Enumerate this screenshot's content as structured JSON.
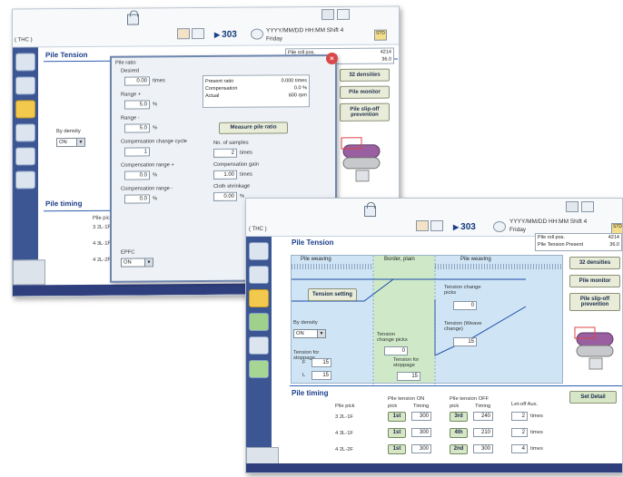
{
  "back": {
    "mode_label": "THC",
    "speed": "303",
    "date_line1": "YYYY/MM/DD HH:MM Shift 4",
    "date_line2": "Friday",
    "std_label": "STD",
    "panel_title": "Pile Tension",
    "info": [
      {
        "label": "Pile roll pos.",
        "value": "4214"
      },
      {
        "label": "",
        "value": "36.0"
      }
    ],
    "buttons": {
      "densities": "32 densities",
      "monitor": "Pile monitor",
      "slipoff": "Pile slip-off prevention"
    },
    "by_density_label": "By density",
    "by_density_value": "ON",
    "pile_timing_title": "Pile timing",
    "timing_rows": [
      "3 2L-1F",
      "4 3L-1F",
      "4 2L-2F"
    ],
    "timing_header": "Pile pick",
    "dialog": {
      "pile_ratio_label": "Pile ratio",
      "desired_label": "Desired",
      "desired_value": "0.00",
      "desired_unit": "times",
      "range_plus_label": "Range +",
      "range_plus_value": "5.0",
      "range_minus_label": "Range -",
      "range_minus_value": "5.0",
      "pct": "%",
      "comp_cycle_label": "Compensation change cycle",
      "comp_cycle_value": "1",
      "comp_range_plus_label": "Compensation range +",
      "comp_range_plus_value": "0.0",
      "comp_range_minus_label": "Compensation range -",
      "comp_range_minus_value": "0.0",
      "present_ratio_label": "Present ratio",
      "present_ratio_value": "0.000 times",
      "compensation_label": "Compensation",
      "compensation_value": "0.0 %",
      "actual_label": "Actual",
      "actual_value": "600 rpm",
      "measure_button": "Measure pile ratio",
      "samples_label": "No. of samples",
      "samples_value": "2",
      "samples_unit": "times",
      "comp_gain_label": "Compensation gain",
      "comp_gain_value": "1.00",
      "comp_gain_unit": "times",
      "cloth_shrink_label": "Cloth shrinkage",
      "cloth_shrink_value": "0.00",
      "epfc_label": "EPFC",
      "epfc_value": "ON"
    }
  },
  "front": {
    "mode_label": "THC",
    "speed": "303",
    "date_line1": "YYYY/MM/DD HH:MM Shift 4",
    "date_line2": "Friday",
    "std_label": "STD",
    "panel_title": "Pile Tension",
    "info": [
      {
        "label": "Pile roll pos.",
        "value": "4214"
      },
      {
        "label": "Pile Tension Present",
        "value": "36.0"
      }
    ],
    "buttons": {
      "densities": "32 densities",
      "monitor": "Pile monitor",
      "slipoff": "Pile slip-off prevention",
      "set_detail": "Set Detail",
      "tension_setting": "Tension setting"
    },
    "zones": {
      "left": "Pile weaving",
      "mid": "Border, plain",
      "right": "Pile weaving"
    },
    "by_density_label": "By density",
    "by_density_value": "ON",
    "tension_change_picks_label1": "Tension change picks",
    "tension_change_picks_value1": "0",
    "tension_change_picks_label2": "Tension change picks",
    "tension_change_picks_value2": "0",
    "tension_weave_label": "Tension (Weave change)",
    "tension_weave_value": "15",
    "tension_stoppage_label1": "Tension for stoppage",
    "tension_stoppage_label2": "Tension for stoppage",
    "tension_stoppage_value2": "15",
    "f_label": "F",
    "f_value": "15",
    "l_label": "L",
    "l_value": "15",
    "pile_timing_title": "Pile timing",
    "timing_headers": {
      "pick": "Pile pick",
      "on": "Pile tension ON",
      "off": "Pile tension OFF",
      "letoff": "Let-off Aux.",
      "pick_col": "pick",
      "timing_col": "Timing"
    },
    "timing_rows": [
      {
        "pick": "3 2L-1F",
        "on_pick": "1st",
        "on_timing": "300",
        "off_pick": "3rd",
        "off_timing": "240",
        "letoff": "2",
        "unit": "times"
      },
      {
        "pick": "4 3L-1F",
        "on_pick": "1st",
        "on_timing": "300",
        "off_pick": "4th",
        "off_timing": "210",
        "letoff": "2",
        "unit": "times"
      },
      {
        "pick": "4 2L-2F",
        "on_pick": "1st",
        "on_timing": "300",
        "off_pick": "2nd",
        "off_timing": "300",
        "letoff": "4",
        "unit": "times"
      }
    ]
  }
}
